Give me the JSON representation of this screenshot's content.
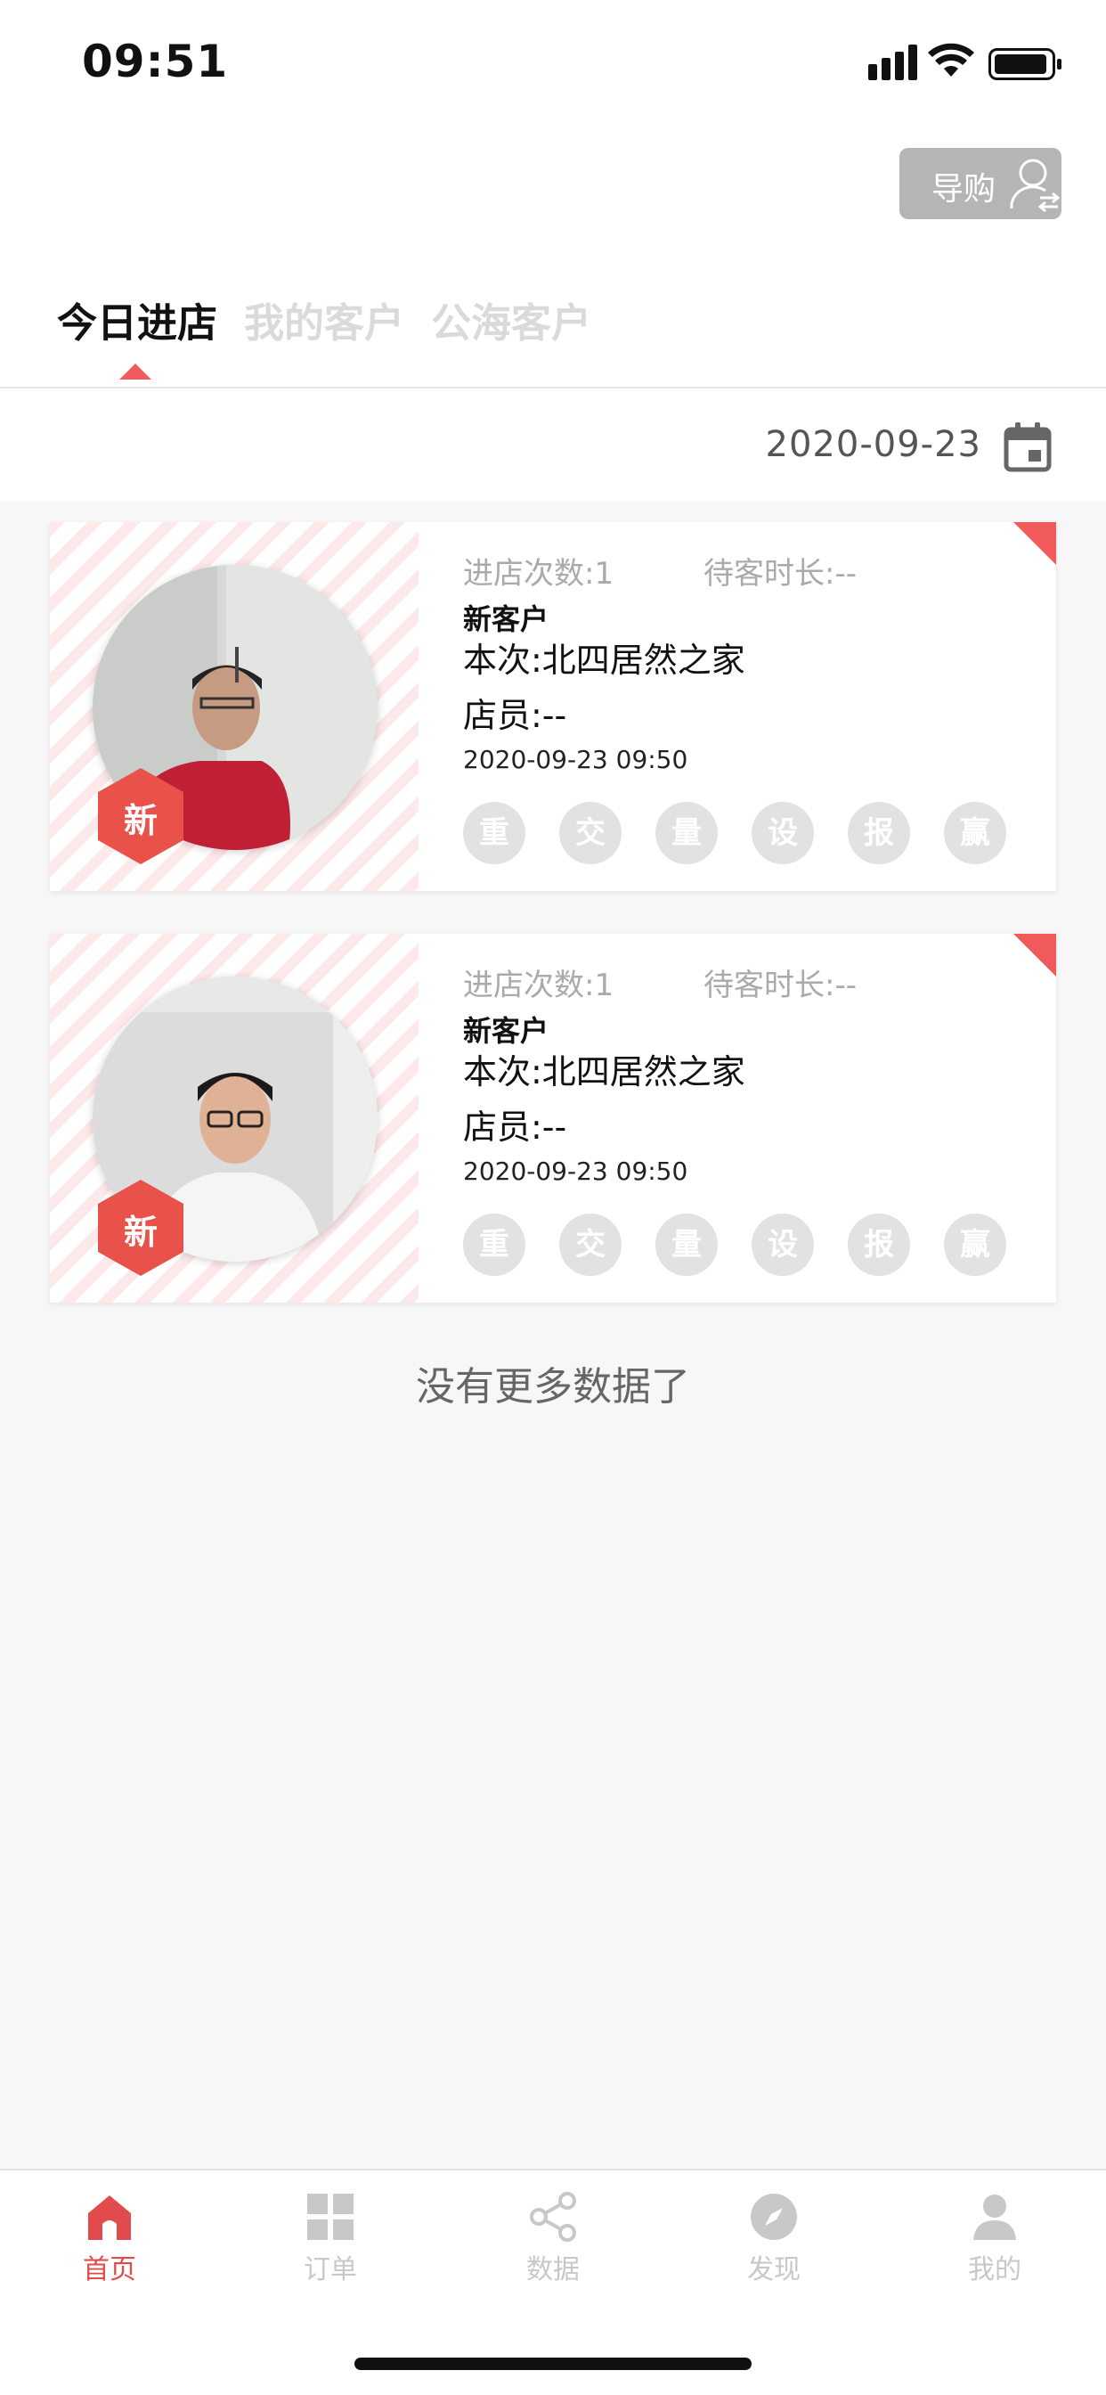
{
  "status_bar": {
    "time": "09:51"
  },
  "guide_button": {
    "label": "导购"
  },
  "tabs": [
    {
      "label": "今日进店",
      "active": true
    },
    {
      "label": "我的客户",
      "active": false
    },
    {
      "label": "公海客户",
      "active": false
    }
  ],
  "date": "2020-09-23",
  "customers": [
    {
      "badge": "新",
      "visits": "进店次数:1",
      "wait": "待客时长:--",
      "tag": "新客户",
      "store": "本次:北四居然之家",
      "staff": "店员:--",
      "datetime": "2020-09-23 09:50",
      "actions": [
        "重",
        "交",
        "量",
        "设",
        "报",
        "赢"
      ]
    },
    {
      "badge": "新",
      "visits": "进店次数:1",
      "wait": "待客时长:--",
      "tag": "新客户",
      "store": "本次:北四居然之家",
      "staff": "店员:--",
      "datetime": "2020-09-23 09:50",
      "actions": [
        "重",
        "交",
        "量",
        "设",
        "报",
        "赢"
      ]
    }
  ],
  "no_more": "没有更多数据了",
  "tabbar": [
    {
      "label": "首页",
      "icon": "home-icon",
      "active": true
    },
    {
      "label": "订单",
      "icon": "grid-icon",
      "active": false
    },
    {
      "label": "数据",
      "icon": "share-icon",
      "active": false
    },
    {
      "label": "发现",
      "icon": "compass-icon",
      "active": false
    },
    {
      "label": "我的",
      "icon": "person-icon",
      "active": false
    }
  ],
  "colors": {
    "accent": "#f05a5a",
    "active_tab": "#e24b4b",
    "inactive": "#c8c8c8"
  }
}
